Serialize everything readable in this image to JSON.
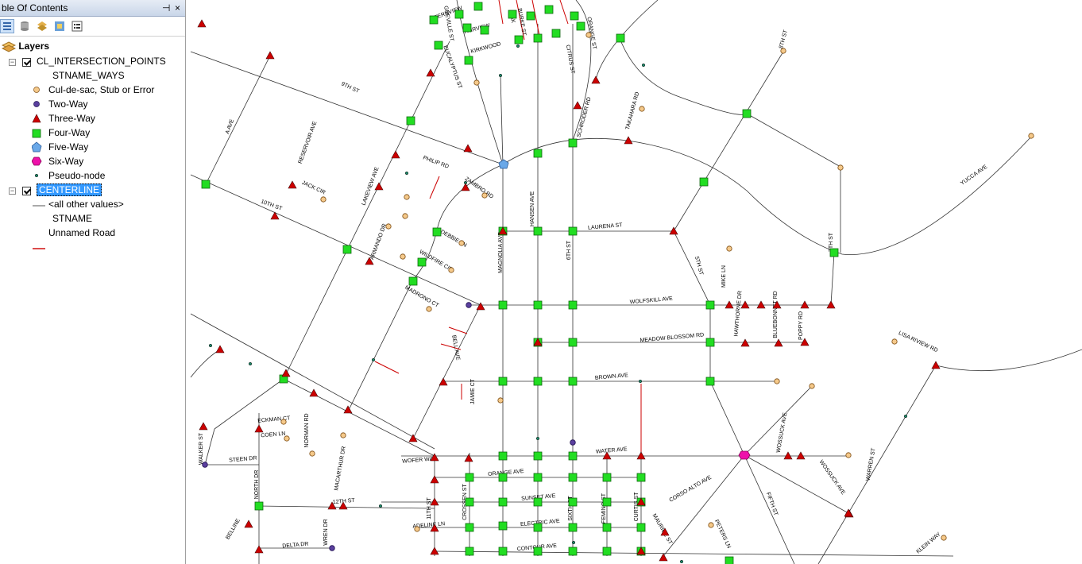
{
  "toc": {
    "title": "ble Of Contents",
    "pin_glyph": "⊣",
    "close_glyph": "×",
    "toolbar_icons": [
      "list-by-drawing-order-icon",
      "list-by-source-icon",
      "list-by-visibility-icon",
      "list-by-selection-icon",
      "options-icon"
    ],
    "layers_label": "Layers",
    "layer1": {
      "name": "CL_INTERSECTION_POINTS",
      "field": "STNAME_WAYS",
      "classes": [
        {
          "label": "Cul-de-sac, Stub or Error",
          "symbol": "circle",
          "color": "#f5c98a"
        },
        {
          "label": "Two-Way",
          "symbol": "circle",
          "color": "#5a3f9e"
        },
        {
          "label": "Three-Way",
          "symbol": "triangle",
          "color": "#cc0000"
        },
        {
          "label": "Four-Way",
          "symbol": "square",
          "color": "#22dd22"
        },
        {
          "label": "Five-Way",
          "symbol": "pentagon",
          "color": "#6aa8e8"
        },
        {
          "label": "Six-Way",
          "symbol": "hexagon",
          "color": "#ee11aa"
        },
        {
          "label": "Pseudo-node",
          "symbol": "dot",
          "color": "#1f8a6a"
        }
      ]
    },
    "layer2": {
      "name": "CENTERLINE",
      "classes": [
        {
          "label": "<all other values>",
          "symbol": "line",
          "color": "#555555"
        },
        {
          "label": "STNAME",
          "symbol": "none",
          "color": ""
        },
        {
          "label": "Unnamed Road",
          "symbol": "line",
          "color": "#cc0000"
        }
      ]
    }
  },
  "map": {
    "street_labels": [
      "FERNVIEW",
      "GREVILLE ST",
      "FAIRVIEW",
      "OAK",
      "BURKE ST",
      "ORANGE ST",
      "KIRKWOOD",
      "CITRUS ST",
      "EUCALYPTUS ST",
      "8TH ST",
      "9TH ST",
      "A AVE",
      "RESERVOIR AVE",
      "SCHRODER RD",
      "TAKAHARA RD",
      "PHILIP RD",
      "ZAMBRO RD",
      "JACK CIR",
      "10TH ST",
      "LAKEVIEW AVE",
      "HANSEN AVE",
      "MAGNOLIA AVE",
      "6TH ST",
      "LAURENA ST",
      "YUCCA AVE",
      "ARMANDO DR",
      "DEBBIE LN",
      "WILDFIRE CIR",
      "5TH ST",
      "7TH ST",
      "MIKE LN",
      "MADRONO CT",
      "WOLFSKILL AVE",
      "HAWTHORNE DR",
      "BLUEBONNET RD",
      "POPPY RD",
      "MEADOW BLOSSOM RD",
      "LISA RIVIEW RD",
      "BELL AVE",
      "BROWN AVE",
      "JAMIE CT",
      "ECKMAN CT",
      "COEN LN",
      "NORMAN RD",
      "WALKER ST",
      "STEEN DR",
      "MACARTHUR DR",
      "WOFER WAY",
      "WATER AVE",
      "WOSSUCK AVE",
      "WARREN ST",
      "ORANGE AVE",
      "NORTH DR",
      "12TH ST",
      "11TH ST",
      "CROSSEN ST",
      "SUNSET AVE",
      "SIXTH ST",
      "FEMINO ST",
      "CURTIS ST",
      "CORSO ALTO AVE",
      "FIFTH ST",
      "WOSSUCK AVE",
      "ADELINE LN",
      "ELECTRIC AVE",
      "MAURICE ST",
      "BELLINE",
      "DELTA DR",
      "WREN DR",
      "CONTOUR AVE",
      "PETERS LN",
      "KLEIN WAY"
    ]
  }
}
